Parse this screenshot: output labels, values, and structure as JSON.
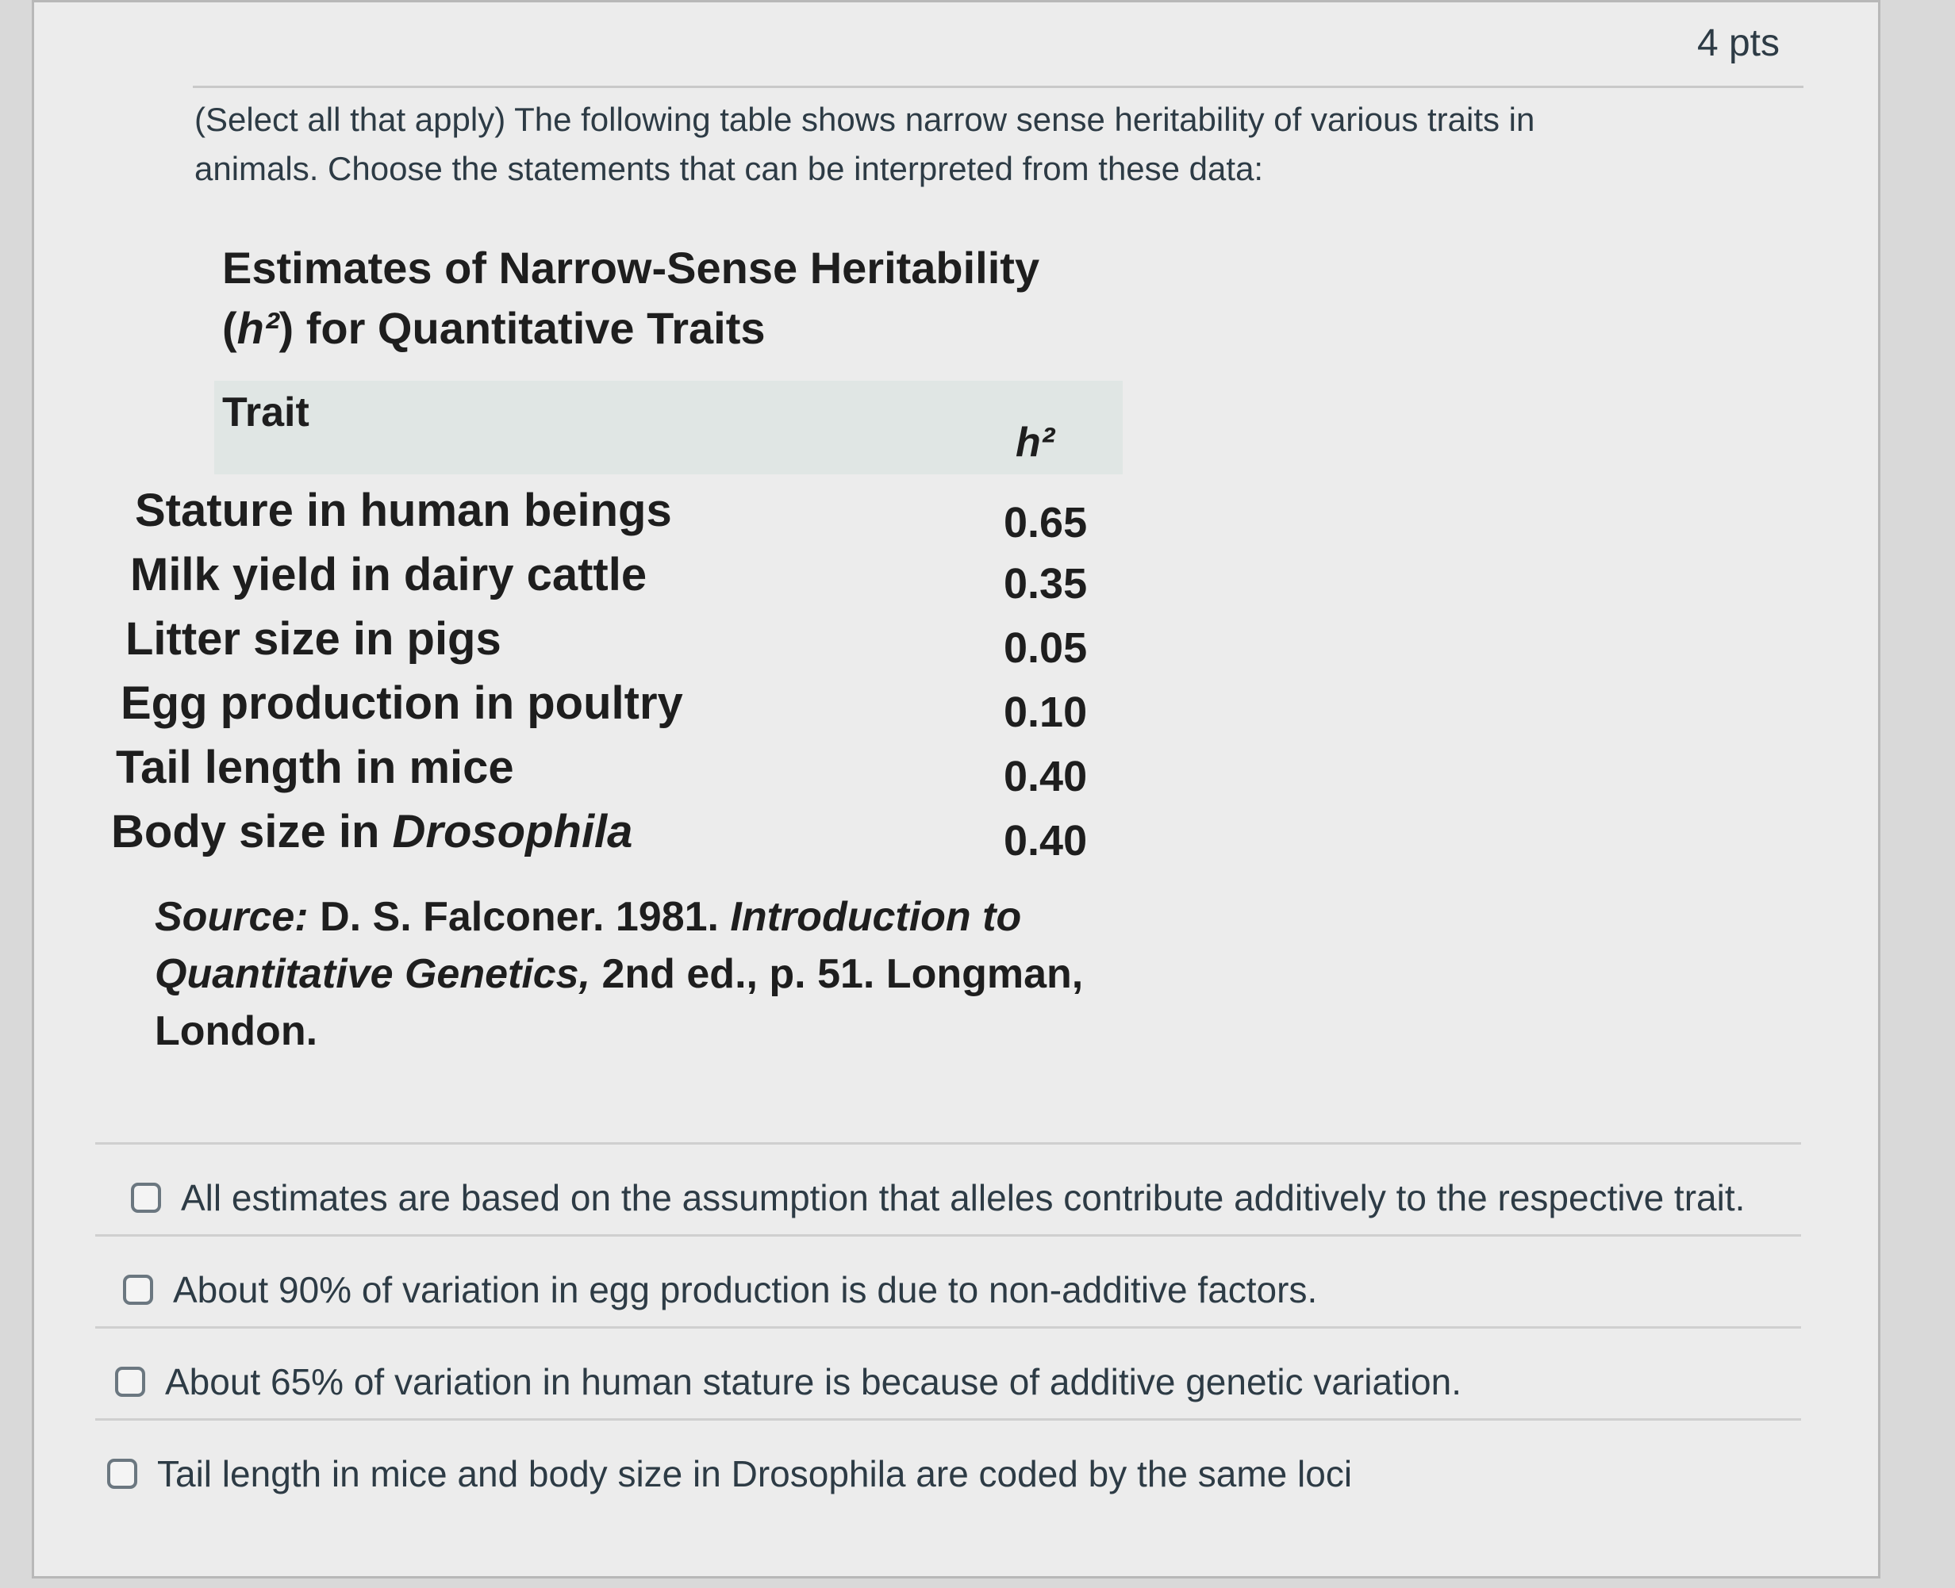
{
  "header": {
    "points": "4 pts"
  },
  "question": {
    "prompt": "(Select all that apply) The following table shows narrow sense heritability of various traits in animals. Choose the statements that can be interpreted from these data:"
  },
  "figure": {
    "title_line1": "Estimates of Narrow-Sense Heritability",
    "title_line2_prefix": "(",
    "title_line2_h2": "h²",
    "title_line2_suffix": ") for Quantitative Traits",
    "col_trait": "Trait",
    "col_h2": "h²",
    "rows": [
      {
        "trait": "Stature in human beings",
        "h2": "0.65"
      },
      {
        "trait": "Milk yield in dairy cattle",
        "h2": "0.35"
      },
      {
        "trait": "Litter size in pigs",
        "h2": "0.05"
      },
      {
        "trait": "Egg production in poultry",
        "h2": "0.10"
      },
      {
        "trait": "Tail length in mice",
        "h2": "0.40"
      },
      {
        "trait": "Body size in ",
        "trait_italic": "Drosophila",
        "h2": "0.40"
      }
    ],
    "source_prefix": "Source: ",
    "source_author": "D. S. Falconer. 1981. ",
    "source_book": "Introduction to Quantitative Genetics,",
    "source_rest": " 2nd ed., p. 51. Longman, London."
  },
  "answers": [
    {
      "label": "All estimates are based on the assumption that alleles contribute additively to the respective trait.",
      "checked": false
    },
    {
      "label": "About 90% of variation in egg production is due to non-additive factors.",
      "checked": false
    },
    {
      "label": "About 65% of variation in human stature is because of additive genetic variation.",
      "checked": false
    },
    {
      "label": "Tail length in mice and body size in Drosophila are coded by the same loci",
      "checked": false
    }
  ]
}
